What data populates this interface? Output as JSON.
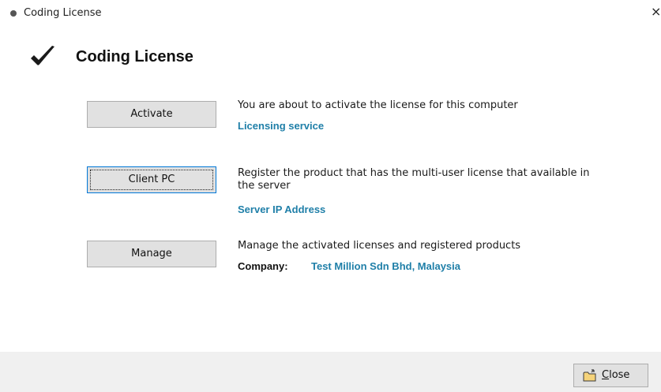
{
  "window": {
    "title": "Coding License",
    "close_glyph": "×"
  },
  "header": {
    "icon": "checkmark-icon",
    "title": "Coding License"
  },
  "actions": [
    {
      "button_label": "Activate",
      "description": "You are about to activate the license for this computer",
      "link": "Licensing service"
    },
    {
      "button_label": "Client PC",
      "description": "Register the product that has the multi-user license that available in the server",
      "link": "Server IP Address"
    },
    {
      "button_label": "Manage",
      "description": "Manage the activated licenses and registered products",
      "company_label": "Company:",
      "company_value": "Test Million Sdn Bhd, Malaysia"
    }
  ],
  "footer": {
    "close_button": {
      "mnemonic": "C",
      "rest": "lose",
      "icon": "folder-exit-icon"
    }
  },
  "colors": {
    "link": "#1f7fa8",
    "footer_bg": "#f0f0f0",
    "button_bg": "#e1e1e1"
  }
}
